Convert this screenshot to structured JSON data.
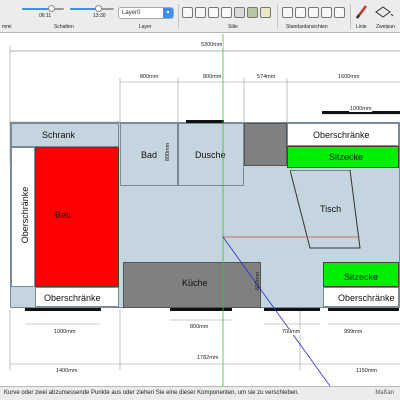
{
  "toolbar": {
    "left_label": "mmi",
    "shadows": {
      "label": "Schatten",
      "time_start": "06:11",
      "time_end": "13:30"
    },
    "layer": {
      "label": "Layer",
      "value": "Layer0"
    },
    "style_label": "Stile",
    "standard_views_label": "Standardansichten",
    "line_label": "Linie",
    "two_point_label": "Zweipun"
  },
  "plan": {
    "overall_width": "5300mm",
    "rooms": {
      "schrank": "Schrank",
      "oberschraenke_top": "Oberschränke",
      "bett": "Bett",
      "oberschraenke_left": "Oberschränke",
      "oberschraenke_bottom_left": "Oberschränke",
      "bad": "Bad",
      "dusche": "Dusche",
      "sitzecke_top": "Sitzecke",
      "tisch": "Tisch",
      "kueche": "Küche",
      "sitzecke_bottom": "Sitzecke",
      "oberschraenke_bottom_right": "Oberschränke"
    },
    "dims_top": [
      "800mm",
      "800mm",
      "574mm",
      "1600mm",
      "1000mm"
    ],
    "dims_inner": [
      "800mm",
      "602mm"
    ],
    "dims_bottom_windows": [
      "1000mm",
      "800mm",
      "700mm",
      "999mm"
    ],
    "dims_bottom_sections": [
      "1400mm",
      "1782mm",
      "1150mm"
    ]
  },
  "status": {
    "hint": "Kurve oder zwei abzumessende Punkte aus oder ziehen Sie eine dieser Komponenten, um sie zu verschieben.",
    "measure": "Maßan"
  },
  "colors": {
    "wall": "#c5d5e0",
    "bed": "#ff0000",
    "sitting": "#00ee00",
    "gray_block": "#808080",
    "bathroom": "#c5d5e0",
    "axis_green": "#3cbf3c",
    "axis_red": "#d94444",
    "axis_blue": "#2a2ad0"
  }
}
